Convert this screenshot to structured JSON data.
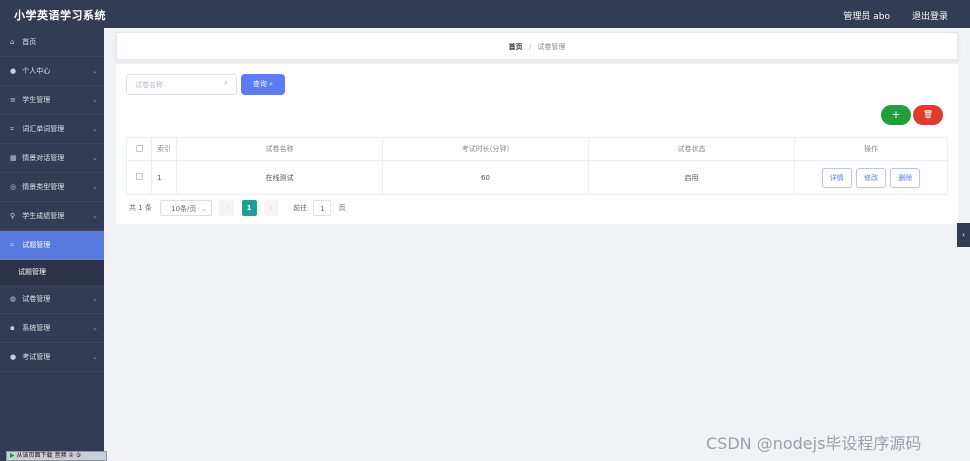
{
  "header": {
    "app_title": "小学英语学习系统",
    "user_label": "管理员 abo",
    "logout_label": "退出登录"
  },
  "sidebar": {
    "items": [
      {
        "label": "首页",
        "icon": "⌂"
      },
      {
        "label": "个人中心",
        "icon": "●"
      },
      {
        "label": "学生管理",
        "icon": "≡"
      },
      {
        "label": "词汇单词管理",
        "icon": "⌗"
      },
      {
        "label": "情景对话管理",
        "icon": "▦"
      },
      {
        "label": "情景类型管理",
        "icon": "◎"
      },
      {
        "label": "学生成绩管理",
        "icon": "♀"
      },
      {
        "label": "试题管理",
        "icon": "⌗"
      },
      {
        "label": "试卷管理",
        "icon": "◍"
      },
      {
        "label": "系统管理",
        "icon": "▪"
      },
      {
        "label": "考试管理",
        "icon": "●"
      }
    ],
    "submenu_label": "试题管理",
    "chevron": "⌄"
  },
  "bottom_toolbar": {
    "text": "从该页面下载 音频",
    "extra": "② ③"
  },
  "breadcrumb": {
    "home": "首页",
    "separator": "/",
    "current": "试卷管理"
  },
  "search": {
    "placeholder": "试卷名称",
    "button_label": "查询"
  },
  "actions": {
    "add_symbol": "+",
    "delete_symbol": "🗑"
  },
  "table": {
    "headers": [
      "",
      "索引",
      "试卷名称",
      "考试时长(分钟)",
      "试卷状态",
      "操作"
    ],
    "rows": [
      {
        "index": "1",
        "name": "在线测试",
        "duration": "60",
        "status": "启用",
        "ops": [
          "详情",
          "修改",
          "删除"
        ]
      }
    ]
  },
  "pagination": {
    "total": "共 1 条",
    "page_size": "10条/页",
    "current_page": "1",
    "goto_label": "前往",
    "goto_value": "1",
    "goto_unit": "页",
    "prev": "‹",
    "next": "›"
  },
  "watermark": "CSDN @nodejs毕设程序源码",
  "colors": {
    "sidebar_bg": "#343b54",
    "active_menu": "#5b7ae0",
    "primary": "#5b7cf2",
    "success": "#249e3d",
    "danger": "#e03c2e",
    "page_active": "#1aa094"
  }
}
